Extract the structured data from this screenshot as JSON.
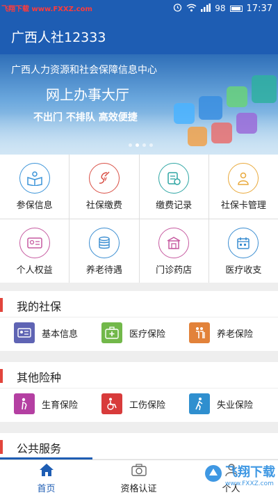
{
  "status_bar": {
    "watermark": "飞翔下载 www.FXXZ.com",
    "battery": "98",
    "time": "17:37"
  },
  "app": {
    "title": "广西人社12333"
  },
  "banner": {
    "line1": "广西人力资源和社会保障信息中心",
    "line2": "网上办事大厅",
    "line3": "不出门  不排队  高效便捷",
    "slides": 4,
    "active_slide": 2
  },
  "grid": [
    {
      "label": "参保信息",
      "icon": "book-person-icon",
      "color": "#3a93d8"
    },
    {
      "label": "社保缴费",
      "icon": "payment-pen-icon",
      "color": "#d94f45"
    },
    {
      "label": "缴费记录",
      "icon": "record-icon",
      "color": "#2fa6a4"
    },
    {
      "label": "社保卡管理",
      "icon": "card-person-icon",
      "color": "#e9a93b"
    },
    {
      "label": "个人权益",
      "icon": "id-card-icon",
      "color": "#c65aa0"
    },
    {
      "label": "养老待遇",
      "icon": "coins-icon",
      "color": "#3a8dd1"
    },
    {
      "label": "门诊药店",
      "icon": "pharmacy-icon",
      "color": "#c65aa0"
    },
    {
      "label": "医疗收支",
      "icon": "calendar-icon",
      "color": "#3a8dd1"
    }
  ],
  "sections": [
    {
      "title": "我的社保",
      "items": [
        {
          "label": "基本信息",
          "icon": "id-card-icon",
          "color": "#5f64b4"
        },
        {
          "label": "医疗保险",
          "icon": "medical-kit-icon",
          "color": "#72b84a"
        },
        {
          "label": "养老保险",
          "icon": "elderly-icon",
          "color": "#e2823a"
        }
      ]
    },
    {
      "title": "其他险种",
      "items": [
        {
          "label": "生育保险",
          "icon": "maternity-icon",
          "color": "#b43fa2"
        },
        {
          "label": "工伤保险",
          "icon": "wheelchair-icon",
          "color": "#d83b3b"
        },
        {
          "label": "失业保险",
          "icon": "walking-icon",
          "color": "#2f8fcf"
        }
      ]
    },
    {
      "title": "公共服务",
      "items": []
    }
  ],
  "bottom_nav": [
    {
      "label": "首页",
      "icon": "home-icon",
      "active": true
    },
    {
      "label": "资格认证",
      "icon": "camera-icon",
      "active": false
    },
    {
      "label": "个人",
      "icon": "person-icon",
      "active": false
    }
  ],
  "watermark_br": {
    "text": "飞翔下载",
    "url": "www.FXXZ.com"
  },
  "colors": {
    "primary": "#1e5db3",
    "accent_bar": "#e2453c"
  }
}
